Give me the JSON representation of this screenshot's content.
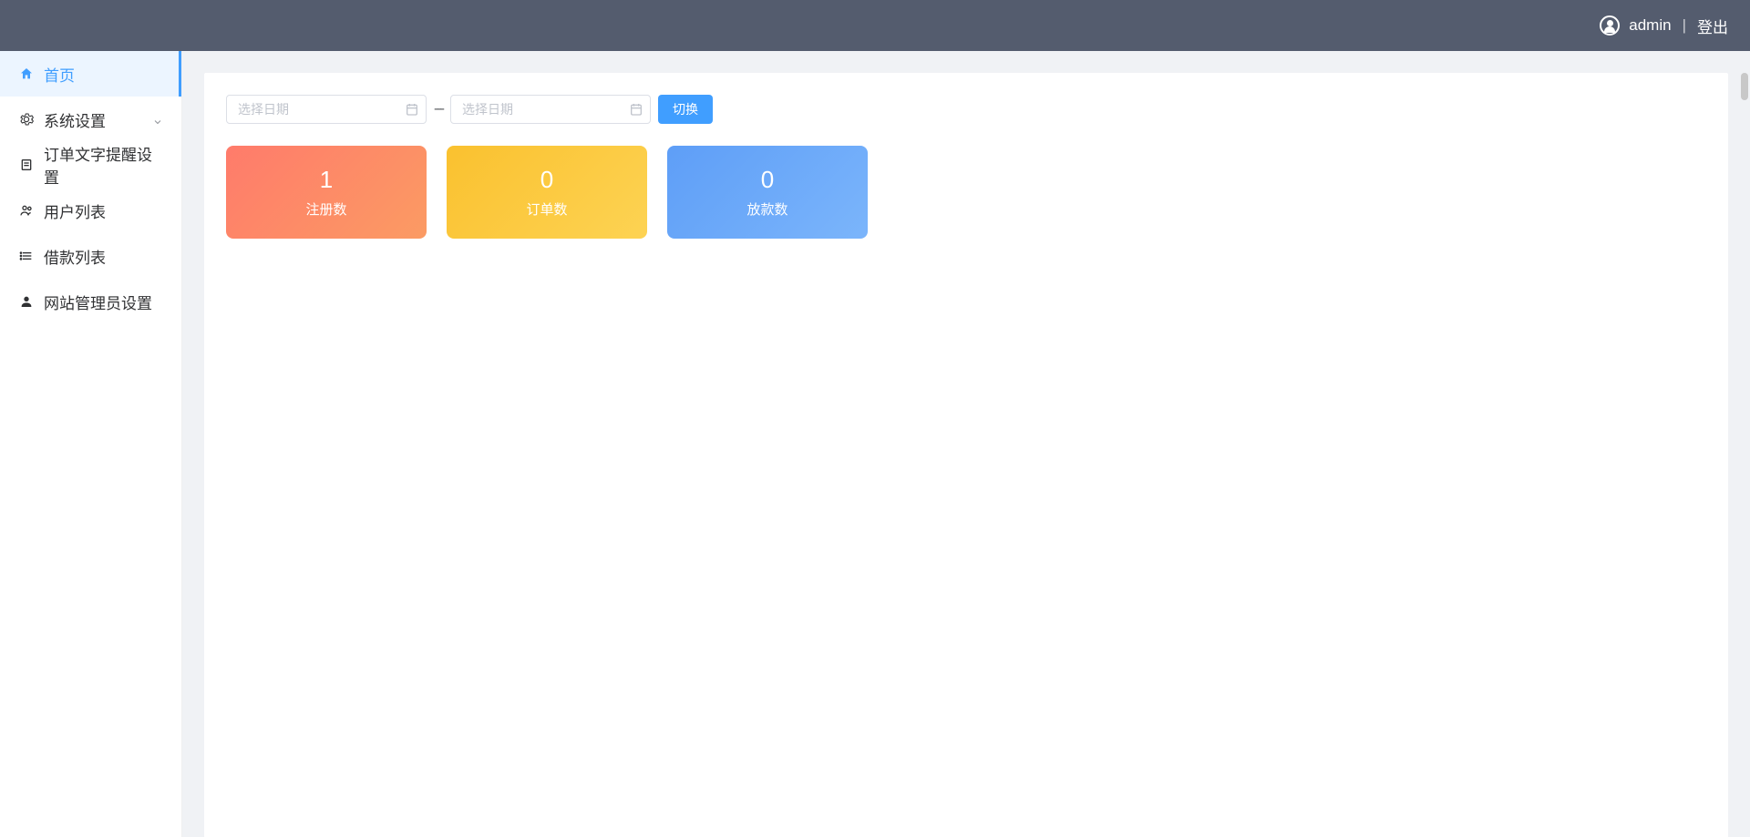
{
  "header": {
    "username": "admin",
    "logout": "登出",
    "separator": "|"
  },
  "sidebar": {
    "items": [
      {
        "label": "首页",
        "icon": "home",
        "active": true,
        "expandable": false
      },
      {
        "label": "系统设置",
        "icon": "gear",
        "active": false,
        "expandable": true
      },
      {
        "label": "订单文字提醒设置",
        "icon": "doc",
        "active": false,
        "expandable": false
      },
      {
        "label": "用户列表",
        "icon": "users",
        "active": false,
        "expandable": false
      },
      {
        "label": "借款列表",
        "icon": "list",
        "active": false,
        "expandable": false
      },
      {
        "label": "网站管理员设置",
        "icon": "person",
        "active": false,
        "expandable": false
      }
    ]
  },
  "filters": {
    "date_start_placeholder": "选择日期",
    "date_end_placeholder": "选择日期",
    "range_separator": "---",
    "toggle_button": "切换"
  },
  "stats": [
    {
      "value": "1",
      "label": "注册数"
    },
    {
      "value": "0",
      "label": "订单数"
    },
    {
      "value": "0",
      "label": "放款数"
    }
  ]
}
